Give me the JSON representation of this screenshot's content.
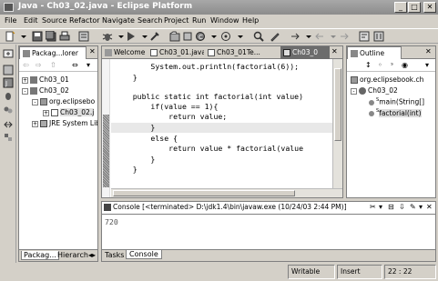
{
  "window": {
    "title": "Java - Ch03_02.java - Eclipse Platform",
    "minimize": "_",
    "maximize": "□",
    "close": "✕"
  },
  "menu": [
    "File",
    "Edit",
    "Source",
    "Refactor",
    "Navigate",
    "Search",
    "Project",
    "Run",
    "Window",
    "Help"
  ],
  "package_explorer": {
    "title": "Packag...lorer",
    "tree": [
      {
        "label": "Ch03_01",
        "expander": "+",
        "icon": "project-icon"
      },
      {
        "label": "Ch03_02",
        "expander": "-",
        "icon": "project-icon"
      },
      {
        "label": "org.eclipsebo",
        "expander": "-",
        "icon": "package-icon"
      },
      {
        "label": "Ch03_02.j",
        "expander": "+",
        "icon": "java-file-icon"
      },
      {
        "label": "JRE System Lib",
        "expander": "+",
        "icon": "library-icon"
      }
    ],
    "bottom_tabs": [
      "Packag...",
      "Hierarch"
    ]
  },
  "editor": {
    "tabs": [
      "Welcome",
      "Ch03_01.java",
      "Ch03_01Te...",
      "Ch03_0"
    ],
    "code": [
      "        System.out.println(factorial(6));",
      "    }",
      "",
      "    public static int factorial(int value)",
      "        if(value == 1){",
      "            return value;",
      "        }",
      "        else {",
      "            return value * factorial(value",
      "        }",
      "    }",
      "}"
    ]
  },
  "outline": {
    "title": "Outline",
    "tree": [
      {
        "label": "org.eclipsebook.ch",
        "icon": "package-icon"
      },
      {
        "label": "Ch03_02",
        "expander": "-",
        "icon": "class-icon"
      },
      {
        "label": "main(String[]",
        "superscript": "S"
      },
      {
        "label": "factorial(int)",
        "superscript": "S"
      }
    ]
  },
  "console": {
    "title": "Console [<terminated> D:\\jdk1.4\\bin\\javaw.exe (10/24/03 2:44 PM)]",
    "output": "720",
    "bottom_tabs": [
      "Tasks",
      "Console"
    ]
  },
  "status": {
    "mode": "Writable",
    "insert": "Insert",
    "position": "22 : 22"
  }
}
